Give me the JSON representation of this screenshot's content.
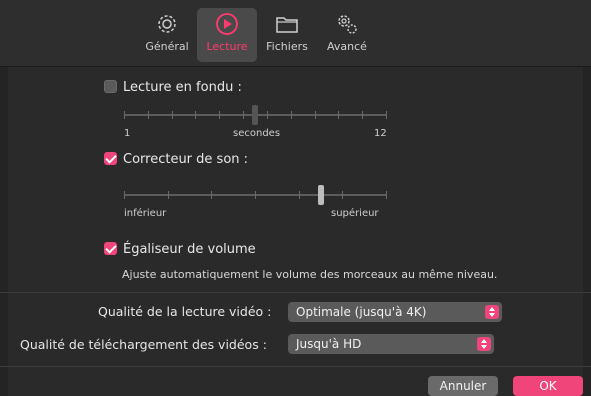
{
  "tabs": [
    {
      "label": "Général",
      "icon": "gear-icon",
      "active": false
    },
    {
      "label": "Lecture",
      "icon": "play-circle-icon",
      "active": true
    },
    {
      "label": "Fichiers",
      "icon": "folder-icon",
      "active": false
    },
    {
      "label": "Avancé",
      "icon": "gears-icon",
      "active": false
    }
  ],
  "crossfade": {
    "label": "Lecture en fondu :",
    "checked": false,
    "min_label": "1",
    "unit_label": "secondes",
    "max_label": "12",
    "value_fraction": 0.5
  },
  "sound_enhancer": {
    "label": "Correcteur de son :",
    "checked": true,
    "min_label": "inférieur",
    "max_label": "supérieur",
    "value_fraction": 0.75
  },
  "volume_leveler": {
    "label": "Égaliseur de volume",
    "checked": true,
    "description": "Ajuste automatiquement le volume des morceaux au même niveau."
  },
  "video_quality": {
    "label": "Qualité de la lecture vidéo :",
    "value": "Optimale (jusqu'à 4K)"
  },
  "download_quality": {
    "label": "Qualité de téléchargement des vidéos :",
    "value": "Jusqu'à HD"
  },
  "buttons": {
    "cancel": "Annuler",
    "ok": "OK"
  },
  "colors": {
    "accent": "#f0457a",
    "background": "#2a2a2a"
  }
}
